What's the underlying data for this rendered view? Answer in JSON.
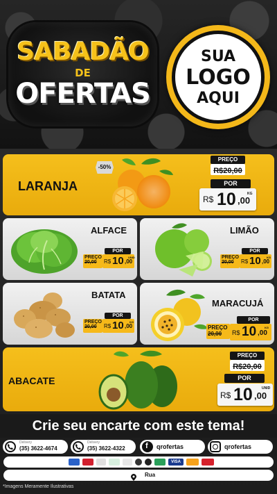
{
  "header": {
    "title_line1": "SABADÃO",
    "title_line2": "DE",
    "title_line3": "OFERTAS",
    "logo_line1": "SUA",
    "logo_line2": "LOGO",
    "logo_line3": "AQUI"
  },
  "products": {
    "laranja": {
      "name": "LARANJA",
      "discount": "-50%",
      "preco_label": "PREÇO",
      "old_price": "R$20,00",
      "por_label": "POR",
      "currency": "R$",
      "price_int": "10",
      "price_cents": ",00",
      "unit": "KG"
    },
    "alface": {
      "name": "ALFACE",
      "preco_label": "PREÇO",
      "old_price": "20,00",
      "por_label": "POR",
      "currency": "R$",
      "price_int": "10",
      "price_cents": ",00",
      "unit": "UNID"
    },
    "limao": {
      "name": "LIMÃO",
      "preco_label": "PREÇO",
      "old_price": "20,00",
      "por_label": "POR",
      "currency": "R$",
      "price_int": "10",
      "price_cents": ",00",
      "unit": "KG"
    },
    "batata": {
      "name": "BATATA",
      "preco_label": "PREÇO",
      "old_price": "20,00",
      "por_label": "POR",
      "currency": "R$",
      "price_int": "10",
      "price_cents": ",00",
      "unit": "KG"
    },
    "maracuja": {
      "name": "MARACUJÁ",
      "preco_label": "PREÇO",
      "old_price": "20,00",
      "por_label": "POR",
      "currency": "R$",
      "price_int": "10",
      "price_cents": ",00",
      "unit": "KG"
    },
    "abacate": {
      "name": "ABACATE",
      "preco_label": "PREÇO",
      "old_price": "R$20,00",
      "por_label": "POR",
      "currency": "R$",
      "price_int": "10",
      "price_cents": ",00",
      "unit": "UNID"
    }
  },
  "footer": {
    "cta": "Crie seu encarte com este tema!",
    "phone1_label": "Delivery",
    "phone1": "(35) 3622-4674",
    "phone2_label": "Delivery",
    "phone2": "(35) 3622-4322",
    "facebook": "qrofertas",
    "instagram": "qrofertas",
    "address": "Rua",
    "disclaimer": "*Imagens Meramente Ilustrativas",
    "payment_icons": [
      "card-icon",
      "card-icon",
      "pix-icon",
      "boleto-icon",
      "card-icon",
      "card-icon",
      "card-icon",
      "card-icon",
      "visa-icon",
      "mastercard-icon",
      "hipercard-icon"
    ]
  },
  "colors": {
    "accent_yellow": "#f5bf1c",
    "dark": "#151515",
    "orange_fruit": "#f28a12",
    "lime_green": "#6fbf2b"
  }
}
